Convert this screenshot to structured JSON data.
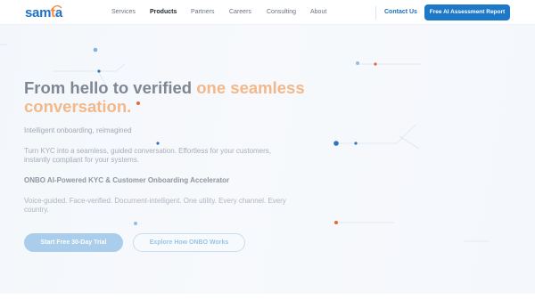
{
  "header": {
    "logo": {
      "prefix": "sam",
      "accent": "t",
      "suffix": "a"
    },
    "nav": [
      {
        "label": "Services",
        "active": false
      },
      {
        "label": "Products",
        "active": true
      },
      {
        "label": "Partners",
        "active": false
      },
      {
        "label": "Careers",
        "active": false
      },
      {
        "label": "Consulting",
        "active": false
      },
      {
        "label": "About",
        "active": false
      }
    ],
    "contact_label": "Contact Us",
    "cta_label": "Free AI Assessment Report"
  },
  "hero": {
    "headline_plain": "From hello to verified ",
    "headline_highlight": "one seamless conversation.",
    "tagline": "Intelligent onboarding, reimagined",
    "description": "Turn KYC into a seamless, guided conversation. Effortless for your customers, instantly compliant for your systems.",
    "subheading": "ONBO AI-Powered KYC & Customer Onboarding Accelerator",
    "features": "Voice-guided. Face-verified. Document-intelligent. One utility. Every channel. Every country.",
    "primary_button": "Start Free 30-Day Trial",
    "secondary_button": "Explore How ONBO Works"
  },
  "colors": {
    "brand_blue": "#1e78c8",
    "accent_orange": "#f28c3c",
    "headline_gray": "#7f8794",
    "highlight_peach": "#f3b88a"
  }
}
